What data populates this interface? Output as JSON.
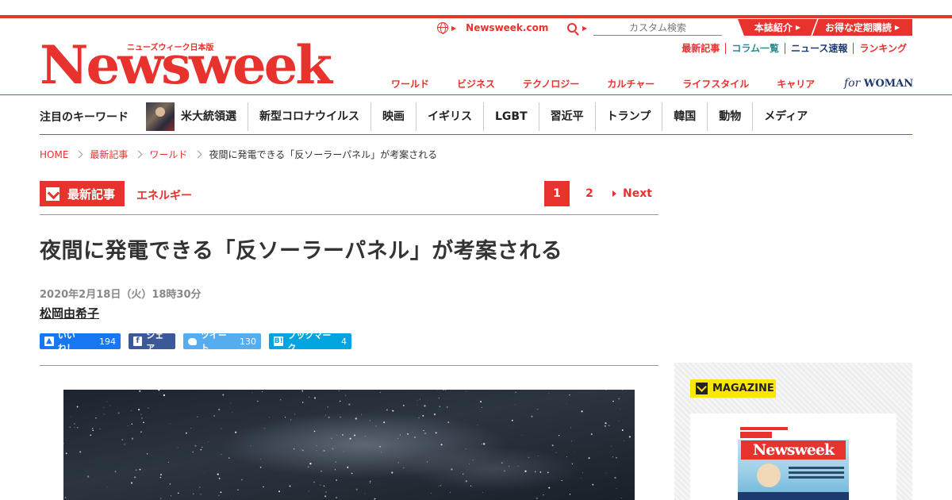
{
  "header": {
    "logo_main": "Newsweek",
    "logo_jp": "ニューズウィーク日本版",
    "site_link": "Newsweek.com",
    "search_placeholder": "カスタム検索",
    "promo_about": "本誌紹介",
    "promo_subscribe": "お得な定期購読",
    "subnav": [
      "最新記事",
      "コラム一覧",
      "ニュース速報",
      "ランキング"
    ],
    "categories": [
      "ワールド",
      "ビジネス",
      "テクノロジー",
      "カルチャー",
      "ライフスタイル",
      "キャリア"
    ],
    "for_woman_for": "for",
    "for_woman_woman": "WOMAN"
  },
  "keywords": {
    "title": "注目のキーワード",
    "items": [
      "米大統領選",
      "新型コロナウイルス",
      "映画",
      "イギリス",
      "LGBT",
      "習近平",
      "トランプ",
      "韓国",
      "動物",
      "メディア"
    ]
  },
  "breadcrumb": [
    "HOME",
    "最新記事",
    "ワールド",
    "夜間に発電できる「反ソーラーパネル」が考案される"
  ],
  "article": {
    "section_badge": "最新記事",
    "tag": "エネルギー",
    "pages": [
      "1",
      "2"
    ],
    "next_label": "Next",
    "headline": "夜間に発電できる「反ソーラーパネル」が考案される",
    "date": "2020年2月18日（火）18時30分",
    "author": "松岡由希子"
  },
  "share": {
    "like_label": "いいね！",
    "like_count": "194",
    "facebook_label": "シェア",
    "tweet_label": "ツイート",
    "tweet_count": "130",
    "hatena_label": "ブックマーク",
    "hatena_count": "4"
  },
  "sidebar": {
    "magazine_label": "MAGAZINE",
    "cover_title": "Newsweek"
  },
  "colors": {
    "brand_red": "#e8322d",
    "teal": "#2c8b8f",
    "navy": "#1d3a6e",
    "magazine_yellow": "#ffe600"
  },
  "icons": [
    "globe-icon",
    "search-icon",
    "caret-right-icon",
    "check-icon",
    "like-icon",
    "facebook-icon",
    "twitter-icon",
    "hatena-icon"
  ]
}
